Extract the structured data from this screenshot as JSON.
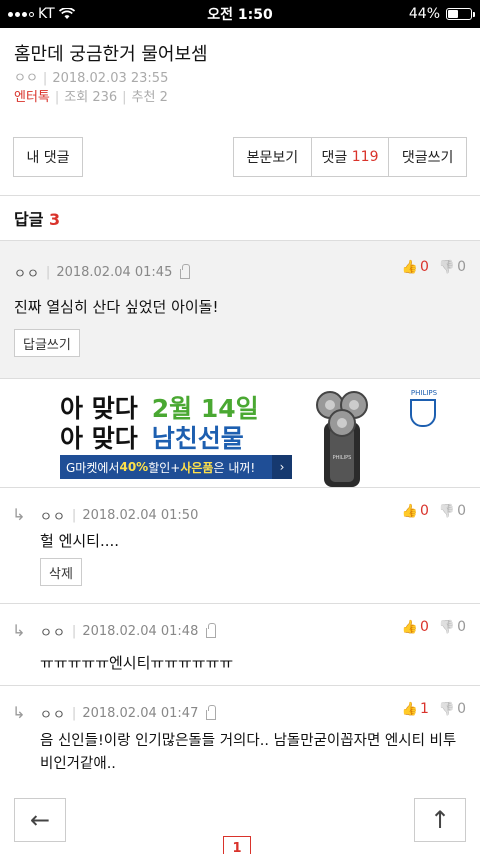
{
  "status": {
    "carrier": "KT",
    "time": "오전 1:50",
    "battery": "44%",
    "battery_level": 0.44
  },
  "post": {
    "title": "홈만데 궁금한거 물어보셈",
    "author": "ㅇㅇ",
    "date": "2018.02.03 23:55",
    "board": "엔터톡",
    "views": "조회 236",
    "recommends": "추천 2"
  },
  "actions": {
    "my_comments": "내 댓글",
    "view_post": "본문보기",
    "comments_label": "댓글",
    "comments_count": "119",
    "write_comment": "댓글쓰기"
  },
  "replies_header": {
    "label": "답글",
    "count": "3"
  },
  "main_reply": {
    "author": "ㅇㅇ",
    "date": "2018.02.04 01:45",
    "up": "0",
    "down": "0",
    "text": "진짜 열심히 산다 싶었던 아이돌!",
    "reply_button": "답글쓰기"
  },
  "ad": {
    "line1_a": "아 맞다",
    "line1_b": "2월 14일",
    "line2_a": "아 맞다",
    "line2_b": "남친선물",
    "bar_1": "G마켓에서 ",
    "bar_2": "40%",
    "bar_3": "할인+",
    "bar_4": "사은품",
    "bar_5": "은 내꺼!",
    "bar_arrow": "›",
    "brand": "PHILIPS",
    "product": "PHILIPS"
  },
  "sub_replies": [
    {
      "author": "ㅇㅇ",
      "date": "2018.02.04 01:50",
      "up": "0",
      "down": "0",
      "text": "헐 엔시티....",
      "button": "삭제",
      "locked": false
    },
    {
      "author": "ㅇㅇ",
      "date": "2018.02.04 01:48",
      "up": "0",
      "down": "0",
      "text": "ㅠㅠㅠㅠㅠ엔시티ㅠㅠㅠㅠㅠㅠ",
      "locked": true
    },
    {
      "author": "ㅇㅇ",
      "date": "2018.02.04 01:47",
      "up": "1",
      "down": "0",
      "text_line1": "음 신인들!이랑 인기많은돌들 거의다.. 남돌만굳이꼽자면 엔시티 비투",
      "text_line2": "비인거같애..",
      "locked": true
    }
  ],
  "nav": {
    "back": "←",
    "top": "↑",
    "page": "1"
  }
}
